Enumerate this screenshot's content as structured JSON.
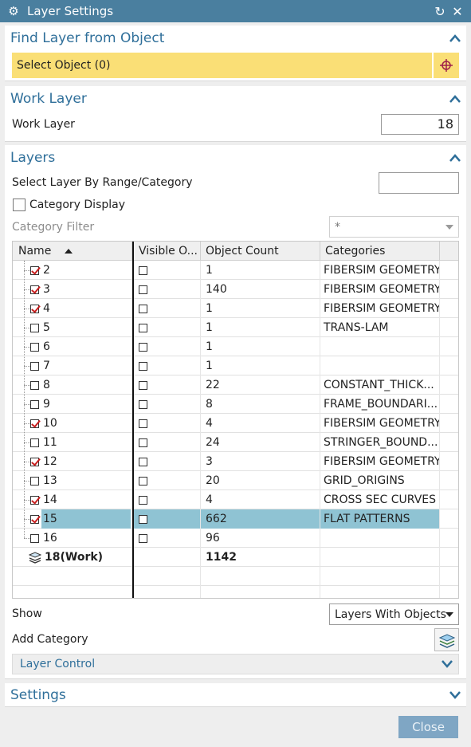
{
  "window": {
    "title": "Layer Settings",
    "icons": [
      "gear-icon",
      "reset-icon",
      "close-icon"
    ],
    "close_glyph": "✕",
    "reset_glyph": "↻"
  },
  "find_layer": {
    "header": "Find Layer from Object",
    "select_object_label": "Select Object (0)",
    "select_color": "#fadf76"
  },
  "work_layer": {
    "header": "Work Layer",
    "label": "Work Layer",
    "value": "18"
  },
  "layers": {
    "header": "Layers",
    "select_by_range_label": "Select Layer By Range/Category",
    "select_by_range_value": "",
    "category_display_label": "Category Display",
    "category_filter_label": "Category Filter",
    "category_filter_value": "*",
    "table": {
      "columns": [
        "Name",
        "Visible O...",
        "Object Count",
        "Categories"
      ],
      "rows": [
        {
          "name": "2",
          "checked": true,
          "visible": false,
          "count": "1",
          "category": "FIBERSIM GEOMETRY"
        },
        {
          "name": "3",
          "checked": true,
          "visible": false,
          "count": "140",
          "category": "FIBERSIM GEOMETRY"
        },
        {
          "name": "4",
          "checked": true,
          "visible": false,
          "count": "1",
          "category": "FIBERSIM GEOMETRY"
        },
        {
          "name": "5",
          "checked": false,
          "visible": false,
          "count": "1",
          "category": "TRANS-LAM"
        },
        {
          "name": "6",
          "checked": false,
          "visible": false,
          "count": "1",
          "category": ""
        },
        {
          "name": "7",
          "checked": false,
          "visible": false,
          "count": "1",
          "category": ""
        },
        {
          "name": "8",
          "checked": false,
          "visible": false,
          "count": "22",
          "category": "CONSTANT_THICK..."
        },
        {
          "name": "9",
          "checked": false,
          "visible": false,
          "count": "8",
          "category": "FRAME_BOUNDARI..."
        },
        {
          "name": "10",
          "checked": true,
          "visible": false,
          "count": "4",
          "category": "FIBERSIM GEOMETRY"
        },
        {
          "name": "11",
          "checked": false,
          "visible": false,
          "count": "24",
          "category": "STRINGER_BOUND..."
        },
        {
          "name": "12",
          "checked": true,
          "visible": false,
          "count": "3",
          "category": "FIBERSIM GEOMETRY"
        },
        {
          "name": "13",
          "checked": false,
          "visible": false,
          "count": "20",
          "category": "GRID_ORIGINS"
        },
        {
          "name": "14",
          "checked": true,
          "visible": false,
          "count": "4",
          "category": "CROSS SEC CURVES"
        },
        {
          "name": "15",
          "checked": true,
          "visible": false,
          "count": "662",
          "category": "FLAT PATTERNS",
          "selected": true
        },
        {
          "name": "16",
          "checked": false,
          "visible": false,
          "count": "96",
          "category": ""
        }
      ],
      "work_row": {
        "name": "18(Work)",
        "count": "1142"
      }
    },
    "show_label": "Show",
    "show_value": "Layers With Objects",
    "add_category_label": "Add Category",
    "layer_control_label": "Layer Control"
  },
  "settings": {
    "header": "Settings"
  },
  "footer": {
    "close_label": "Close"
  },
  "colors": {
    "titlebar": "#4a7f9f",
    "accent": "#2f6f9a",
    "selection": "#8fc3d3",
    "check": "#c81e1e"
  }
}
